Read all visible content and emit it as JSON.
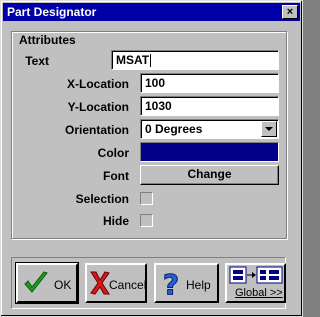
{
  "window": {
    "title": "Part Designator",
    "close_glyph": "×"
  },
  "attributes": {
    "group_title": "Attributes",
    "text_label": "Text",
    "text_value": "MSAT",
    "xloc_label": "X-Location",
    "xloc_value": "100",
    "yloc_label": "Y-Location",
    "yloc_value": "1030",
    "orient_label": "Orientation",
    "orient_value": "0 Degrees",
    "color_label": "Color",
    "color_value": "#00008b",
    "font_label": "Font",
    "font_button": "Change",
    "selection_label": "Selection",
    "selection_checked": false,
    "hide_label": "Hide",
    "hide_checked": false
  },
  "buttons": {
    "ok": "OK",
    "cancel": "Cancel",
    "help": "Help",
    "global": "Global >>"
  },
  "icons": {
    "ok": "green-checkmark-icon",
    "cancel": "red-x-icon",
    "help": "question-mark-icon",
    "global": "global-diagram-icon"
  }
}
